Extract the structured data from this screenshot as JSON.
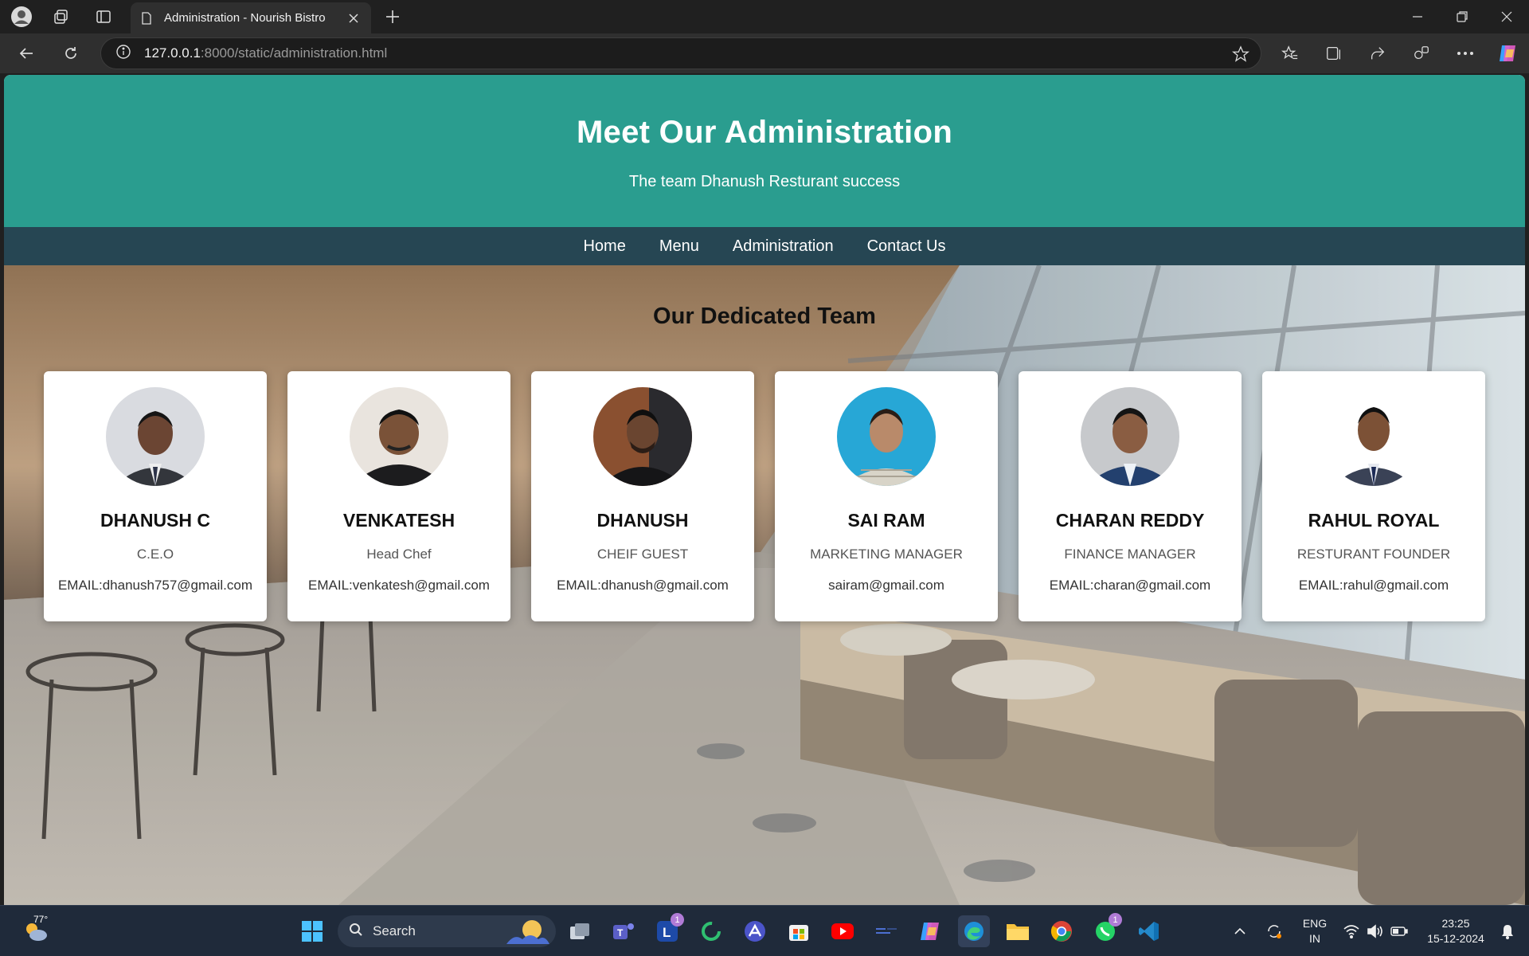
{
  "browser": {
    "tab_title": "Administration - Nourish Bistro",
    "url_host": "127.0.0.1",
    "url_rest": ":8000/static/administration.html"
  },
  "site": {
    "header_title": "Meet Our Administration",
    "header_subtitle": "The team Dhanush Resturant success",
    "nav": [
      "Home",
      "Menu",
      "Administration",
      "Contact Us"
    ],
    "section_title": "Our Dedicated Team",
    "team": [
      {
        "name": "DHANUSH C",
        "role": "C.E.O",
        "email": "EMAIL:dhanush757@gmail.com"
      },
      {
        "name": "VENKATESH",
        "role": "Head Chef",
        "email": "EMAIL:venkatesh@gmail.com"
      },
      {
        "name": "DHANUSH",
        "role": "CHEIF GUEST",
        "email": "EMAIL:dhanush@gmail.com"
      },
      {
        "name": "SAI RAM",
        "role": "MARKETING MANAGER",
        "email": "sairam@gmail.com"
      },
      {
        "name": "CHARAN REDDY",
        "role": "FINANCE MANAGER",
        "email": "EMAIL:charan@gmail.com"
      },
      {
        "name": "RAHUL ROYAL",
        "role": "RESTURANT FOUNDER",
        "email": "EMAIL:rahul@gmail.com"
      }
    ]
  },
  "taskbar": {
    "weather": "77°",
    "search_label": "Search",
    "badge_count": "1",
    "lang_top": "ENG",
    "lang_bottom": "IN",
    "time": "23:25",
    "date": "15-12-2024"
  },
  "colors": {
    "header_bg": "#2a9d8f",
    "nav_bg": "#264653"
  }
}
